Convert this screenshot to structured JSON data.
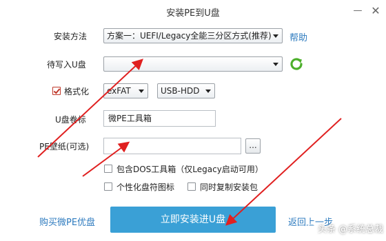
{
  "window": {
    "title": "安装PE到U盘",
    "minimize_symbol": "—",
    "close_symbol": "✕"
  },
  "form": {
    "install_method_label": "安装方法",
    "install_method_value": "方案一：UEFI/Legacy全能三分区方式(推荐)",
    "help_link": "帮助",
    "target_usb_label": "待写入U盘",
    "target_usb_value": "",
    "format_label": "格式化",
    "format_checked": true,
    "filesystem_value": "exFAT",
    "boot_mode_value": "USB-HDD",
    "volume_label_label": "U盘卷标",
    "volume_label_value": "微PE工具箱",
    "wallpaper_label": "PE壁纸(可选)",
    "wallpaper_value": "",
    "browse_button": "...",
    "options": [
      {
        "label": "包含DOS工具箱（仅Legacy启动可用）",
        "checked": false
      },
      {
        "label": "个性化盘符图标",
        "checked": false
      },
      {
        "label": "同时复制安装包",
        "checked": false
      }
    ]
  },
  "footer": {
    "buy_link": "购买微PE优盘",
    "install_button": "立即安装进U盘",
    "back_link": "返回上一步"
  },
  "watermark": {
    "text": "头条 @系统总裁"
  },
  "icons": {
    "refresh": "refresh-icon",
    "arrows": "red-annotation-arrow"
  },
  "colors": {
    "accent_blue": "#3aa0d6",
    "link_blue": "#2e7bbf",
    "refresh_green": "#4caf2a",
    "annotation_red": "#e02020"
  }
}
